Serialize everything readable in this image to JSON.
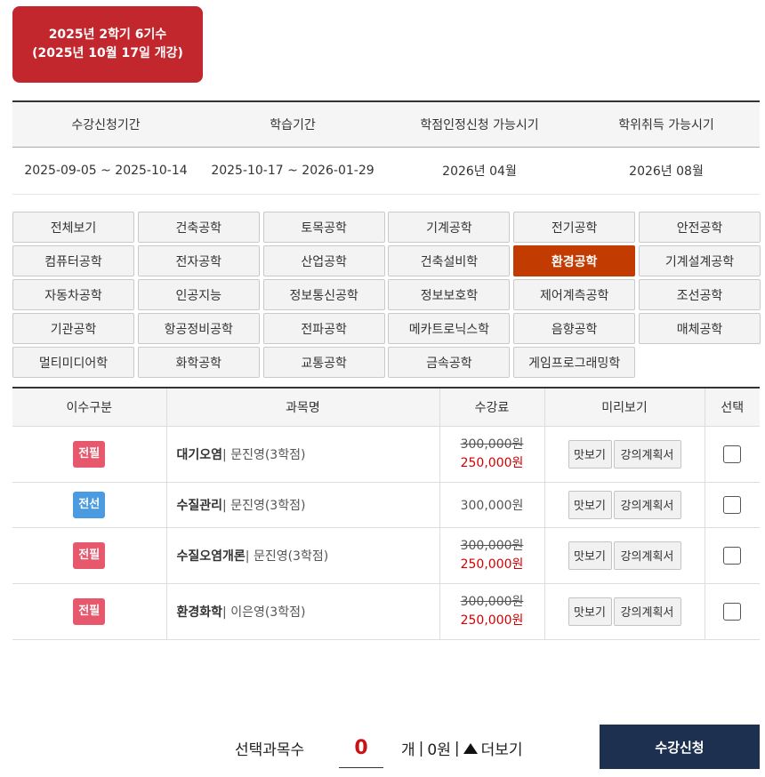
{
  "term": {
    "line1": "2025년 2학기 6기수",
    "line2": "(2025년 10월 17일 개강)"
  },
  "schedule": {
    "headers": [
      "수강신청기간",
      "학습기간",
      "학점인정신청 가능시기",
      "학위취득 가능시기"
    ],
    "values": [
      "2025-09-05 ~ 2025-10-14",
      "2025-10-17 ~ 2026-01-29",
      "2026년 04월",
      "2026년 08월"
    ]
  },
  "majors": [
    "전체보기",
    "건축공학",
    "토목공학",
    "기계공학",
    "전기공학",
    "안전공학",
    "컴퓨터공학",
    "전자공학",
    "산업공학",
    "건축설비학",
    "환경공학",
    "기계설계공학",
    "자동차공학",
    "인공지능",
    "정보통신공학",
    "정보보호학",
    "제어계측공학",
    "조선공학",
    "기관공학",
    "항공정비공학",
    "전파공학",
    "메카트로닉스학",
    "음향공학",
    "매체공학",
    "멀티미디어학",
    "화학공학",
    "교통공학",
    "금속공학",
    "게임프로그래밍학"
  ],
  "active_major": "환경공학",
  "colors": {
    "accent_active": "#c23b00",
    "term_badge": "#c1272d",
    "apply_button": "#1e3050",
    "tag_required": "#e8586c",
    "tag_elective": "#4a9be0"
  },
  "table": {
    "headers": [
      "이수구분",
      "과목명",
      "수강료",
      "미리보기",
      "선택"
    ],
    "rows": [
      {
        "type": "전필",
        "name": "대기오염",
        "detail": "| 문진영(3학점)",
        "price_old": "300,000원",
        "price_new": "250,000원"
      },
      {
        "type": "전선",
        "name": "수질관리",
        "detail": "| 문진영(3학점)",
        "price": "300,000원"
      },
      {
        "type": "전필",
        "name": "수질오염개론",
        "detail": "| 문진영(3학점)",
        "price_old": "300,000원",
        "price_new": "250,000원"
      },
      {
        "type": "전필",
        "name": "환경화학",
        "detail": "| 이은영(3학점)",
        "price_old": "300,000원",
        "price_new": "250,000원"
      }
    ],
    "preview_label": "맛보기",
    "plan_label": "강의계획서"
  },
  "footer": {
    "selected_label": "선택과목수",
    "count": "0",
    "unit": "개",
    "total": "0원",
    "more_label": "더보기",
    "apply_label": "수강신청"
  }
}
